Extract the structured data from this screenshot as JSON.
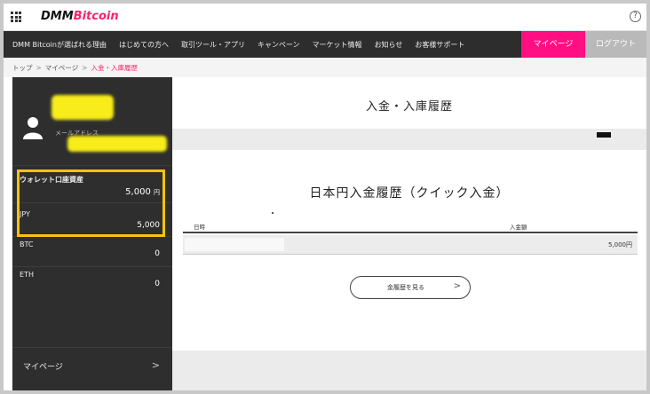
{
  "header": {
    "logo_dmm": "DMM",
    "logo_bitcoin": "Bitcoin",
    "help_icon": "?"
  },
  "nav": {
    "items": [
      "DMM Bitcoinが選ばれる理由",
      "はじめての方へ",
      "取引ツール・アプリ",
      "キャンペーン",
      "マーケット情報",
      "お知らせ",
      "お客様サポート"
    ],
    "mypage_label": "マイページ",
    "logout_label": "ログアウト"
  },
  "breadcrumb": {
    "items": [
      "トップ",
      "マイページ",
      "入金・入庫履歴"
    ],
    "separator": ">"
  },
  "sidebar": {
    "email_label": "メールアドレス",
    "wallet": [
      {
        "label": "ウォレット口座資産",
        "value": "5,000",
        "unit": "円"
      },
      {
        "label": "JPY",
        "value": "5,000",
        "unit": ""
      },
      {
        "label": "BTC",
        "value": "0",
        "unit": ""
      },
      {
        "label": "ETH",
        "value": "0",
        "unit": ""
      }
    ],
    "mypage_link": "マイページ",
    "chevron": ">"
  },
  "main": {
    "page_title": "入金・入庫履歴",
    "section_title": "日本円入金履歴（クイック入金）",
    "table": {
      "col_datetime": "日時",
      "col_amount": "入金額",
      "rows": [
        {
          "amount": "5,000円"
        }
      ]
    },
    "history_button": "金履歴を見る",
    "history_chevron": ">"
  },
  "colors": {
    "brand_pink": "#ff1f6b",
    "mypage_pink": "#ff0f82",
    "highlight_yellow": "#ffc20e",
    "sidebar_bg": "#2e2e2e",
    "nav_bg": "#2d2d2d"
  }
}
